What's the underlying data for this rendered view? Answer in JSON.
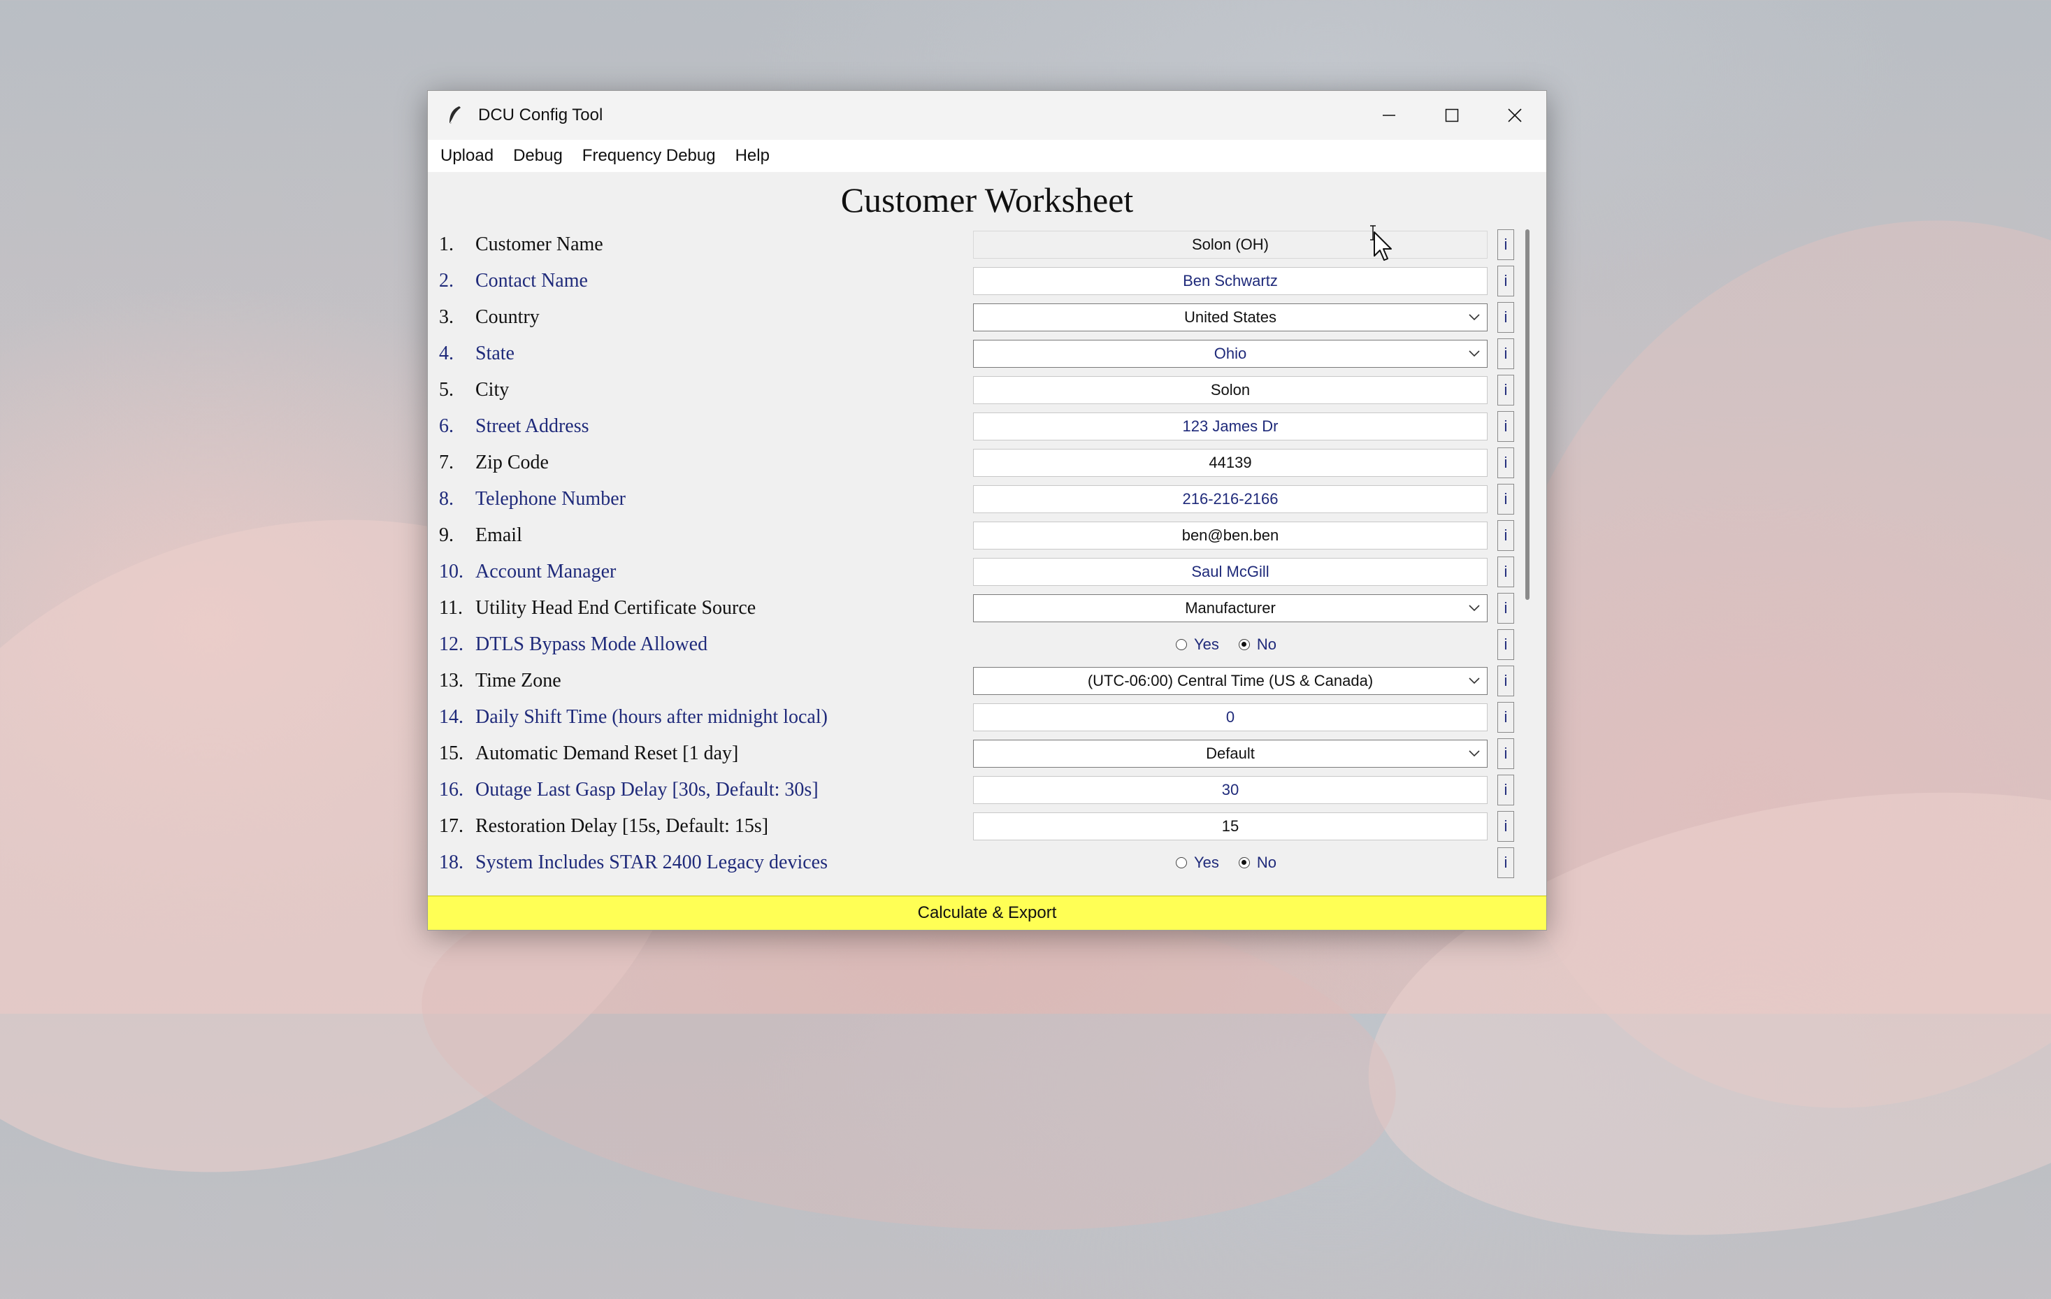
{
  "window": {
    "title": "DCU Config Tool"
  },
  "menu": [
    "Upload",
    "Debug",
    "Frequency Debug",
    "Help"
  ],
  "heading": "Customer Worksheet",
  "rows": [
    {
      "num": "1.",
      "label": "Customer Name",
      "type": "text",
      "value": "Solon (OH)",
      "color": "blk",
      "disabled": true
    },
    {
      "num": "2.",
      "label": "Contact Name",
      "type": "text",
      "value": "Ben Schwartz",
      "color": "blu"
    },
    {
      "num": "3.",
      "label": "Country",
      "type": "select",
      "value": "United States",
      "color": "blk"
    },
    {
      "num": "4.",
      "label": "State",
      "type": "select",
      "value": "Ohio",
      "color": "blu"
    },
    {
      "num": "5.",
      "label": "City",
      "type": "text",
      "value": "Solon",
      "color": "blk"
    },
    {
      "num": "6.",
      "label": "Street Address",
      "type": "text",
      "value": "123 James Dr",
      "color": "blu"
    },
    {
      "num": "7.",
      "label": "Zip Code",
      "type": "text",
      "value": "44139",
      "color": "blk"
    },
    {
      "num": "8.",
      "label": "Telephone Number",
      "type": "text",
      "value": "216-216-2166",
      "color": "blu"
    },
    {
      "num": "9.",
      "label": "Email",
      "type": "text",
      "value": "ben@ben.ben",
      "color": "blk"
    },
    {
      "num": "10.",
      "label": "Account Manager",
      "type": "text",
      "value": "Saul McGill",
      "color": "blu"
    },
    {
      "num": "11.",
      "label": "Utility Head End Certificate Source",
      "type": "select",
      "value": "Manufacturer",
      "color": "blk"
    },
    {
      "num": "12.",
      "label": "DTLS Bypass Mode Allowed",
      "type": "radio",
      "options": [
        "Yes",
        "No"
      ],
      "selected": "No",
      "color": "blu"
    },
    {
      "num": "13.",
      "label": "Time Zone",
      "type": "select",
      "value": "(UTC-06:00) Central Time (US & Canada)",
      "color": "blk"
    },
    {
      "num": "14.",
      "label": "Daily Shift Time (hours after midnight local)",
      "type": "text",
      "value": "0",
      "color": "blu"
    },
    {
      "num": "15.",
      "label": "Automatic Demand Reset [1 day]",
      "type": "select",
      "value": "Default",
      "color": "blk"
    },
    {
      "num": "16.",
      "label": "Outage Last Gasp Delay [30s, Default: 30s]",
      "type": "text",
      "value": "30",
      "color": "blu"
    },
    {
      "num": "17.",
      "label": "Restoration Delay [15s, Default: 15s]",
      "type": "text",
      "value": "15",
      "color": "blk"
    },
    {
      "num": "18.",
      "label": "System Includes STAR 2400 Legacy devices",
      "type": "radio",
      "options": [
        "Yes",
        "No"
      ],
      "selected": "No",
      "color": "blu"
    }
  ],
  "info_label": "i",
  "calc_button": "Calculate & Export",
  "colors": {
    "label_blue": "#1f2a7a",
    "button_yellow": "#ffff55"
  }
}
